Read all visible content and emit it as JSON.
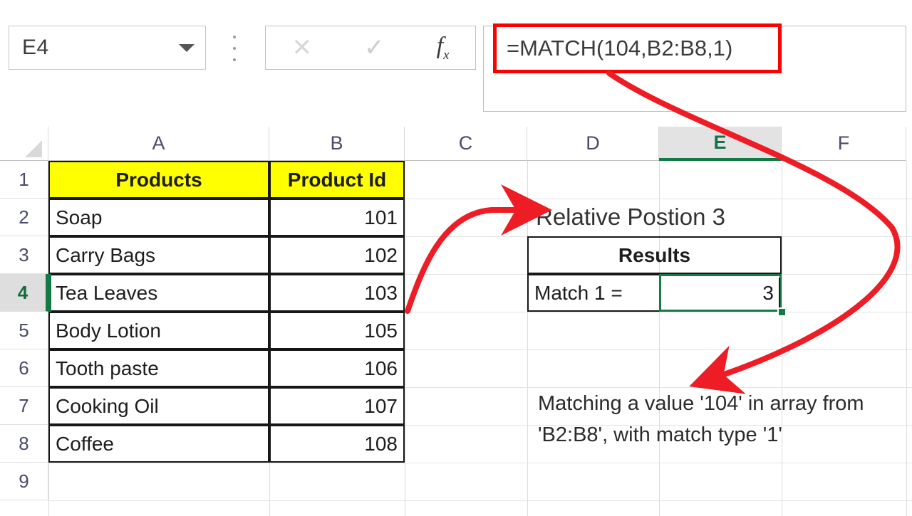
{
  "app": "excel-worksheet",
  "formula_bar": {
    "name_box_value": "E4",
    "name_box_icon": "chevron-down-icon",
    "cancel_icon": "close-icon",
    "confirm_icon": "check-icon",
    "function_icon": "fx-icon",
    "function_label": "f",
    "function_sub": "x",
    "formula": "=MATCH(104,B2:B8,1)",
    "highlight_color": "#ff0000"
  },
  "grid": {
    "columns": [
      "A",
      "B",
      "C",
      "D",
      "E",
      "F"
    ],
    "rows": [
      "1",
      "2",
      "3",
      "4",
      "5",
      "6",
      "7",
      "8",
      "9"
    ],
    "selected_cell": "E4",
    "selected_column": "E",
    "selected_row": "4",
    "header_fill": "#ffff00",
    "selection_color": "#1a7a47"
  },
  "table": {
    "headers": [
      "Products",
      "Product Id"
    ],
    "rows": [
      {
        "product": "Soap",
        "id": "101"
      },
      {
        "product": "Carry Bags",
        "id": "102"
      },
      {
        "product": "Tea Leaves",
        "id": "103"
      },
      {
        "product": "Body Lotion",
        "id": "105"
      },
      {
        "product": "Tooth paste",
        "id": "106"
      },
      {
        "product": "Cooking Oil",
        "id": "107"
      },
      {
        "product": "Coffee",
        "id": "108"
      }
    ]
  },
  "results": {
    "relative_position_label": "Relative Postion 3",
    "results_header": "Results",
    "match_label": "Match 1 =",
    "match_value": "3"
  },
  "annotation": {
    "text": "Matching a value '104' in array from 'B2:B8', with match type '1'",
    "arrow_color": "#ee1c25"
  }
}
